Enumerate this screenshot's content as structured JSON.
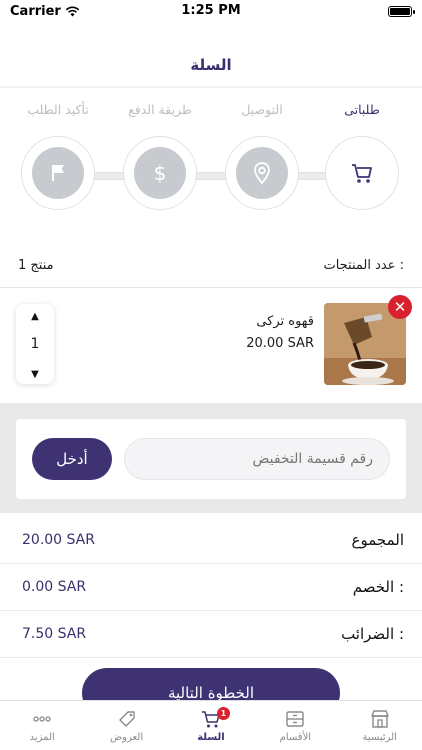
{
  "status_bar": {
    "carrier": "Carrier",
    "time": "1:25 PM",
    "battery_level": 1.0
  },
  "nav": {
    "title": "السلة"
  },
  "steps": [
    {
      "label": "طلباتى",
      "icon": "cart-icon",
      "active": true
    },
    {
      "label": "التوصيل",
      "icon": "location-pin-icon",
      "active": false
    },
    {
      "label": "طريقة الدفع",
      "icon": "dollar-icon",
      "active": false
    },
    {
      "label": "تأكيد الطلب",
      "icon": "flag-icon",
      "active": false
    }
  ],
  "cart": {
    "count_label": "عدد المنتجات :",
    "count_value": "1  منتج"
  },
  "product": {
    "name": "قهوه تركى",
    "price": "20.00 SAR",
    "quantity": "1",
    "remove_symbol": "✕",
    "increase_symbol": "▲",
    "decrease_symbol": "▼"
  },
  "coupon": {
    "placeholder": "رقم قسيمة التخفيض",
    "button_label": "أدخل"
  },
  "totals": [
    {
      "label": "المجموع",
      "value": "20.00 SAR"
    },
    {
      "label": "الخصم :",
      "value": "0.00 SAR"
    },
    {
      "label": "الضرائب :",
      "value": "7.50 SAR"
    }
  ],
  "next_button": "الخطوة التالية",
  "tabs": [
    {
      "label": "المزيد",
      "icon": "more-dots-icon",
      "active": false
    },
    {
      "label": "العروض",
      "icon": "offer-tag-icon",
      "active": false
    },
    {
      "label": "السلة",
      "icon": "cart-icon",
      "active": true,
      "badge": "1"
    },
    {
      "label": "الأقسام",
      "icon": "categories-box-icon",
      "active": false
    },
    {
      "label": "الرئيسية",
      "icon": "store-icon",
      "active": false
    }
  ],
  "colors": {
    "primary": "#3e3272",
    "accent_red": "#d9202e",
    "inactive_step": "#c7cace",
    "band_gray": "#e9e9e9"
  }
}
